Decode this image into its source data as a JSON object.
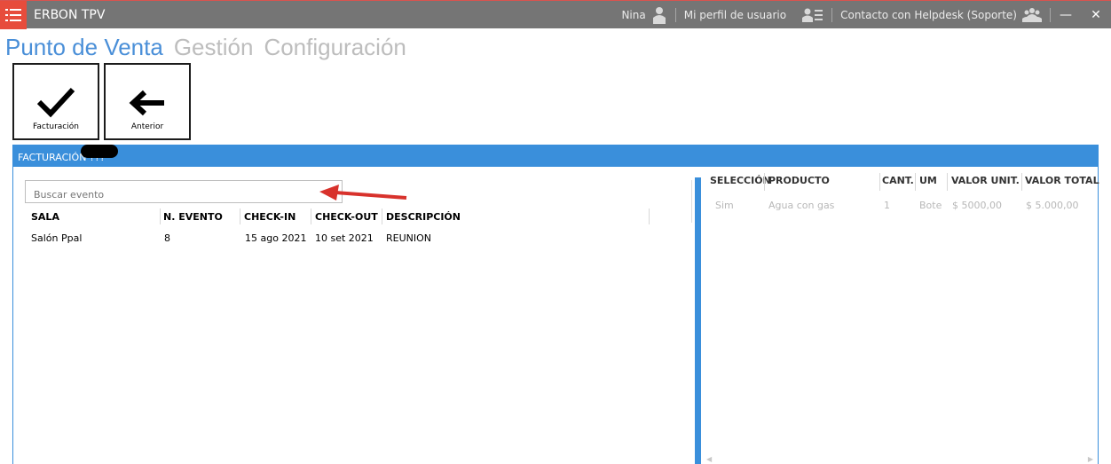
{
  "titlebar": {
    "app_name": "ERBON TPV",
    "user_name": "Nina",
    "profile_label": "Mi perfil de usuario",
    "helpdesk_label": "Contacto con Helpdesk (Soporte)",
    "minimize": "—",
    "close": "✕",
    "accent_color": "#e74c3c",
    "bar_color": "#757575"
  },
  "nav": {
    "tabs": [
      {
        "label": "Punto de Venta",
        "active": true
      },
      {
        "label": "Gestión",
        "active": false
      },
      {
        "label": "Configuración",
        "active": false
      }
    ],
    "active_color": "#4a8fd8"
  },
  "toolbar": {
    "billing_label": "Facturación",
    "back_label": "Anterior"
  },
  "section": {
    "title": "FACTURACIÓN ???",
    "color": "#3a8fdb"
  },
  "events": {
    "search_placeholder": "Buscar evento",
    "columns": [
      "SALA",
      "N. EVENTO",
      "CHECK-IN",
      "CHECK-OUT",
      "DESCRIPCIÓN"
    ],
    "rows": [
      [
        "Salón Ppal",
        "8",
        "15 ago 2021",
        "10 set 2021",
        "REUNION"
      ]
    ]
  },
  "products": {
    "columns": [
      "SELECCIÓN",
      "PRODUCTO",
      "CANT.",
      "UM",
      "VALOR UNIT.",
      "VALOR TOTAL"
    ],
    "rows": [
      [
        "Sim",
        "Agua con gas",
        "1",
        "Botel",
        "$ 5000,00",
        "$ 5.000,00"
      ]
    ]
  }
}
